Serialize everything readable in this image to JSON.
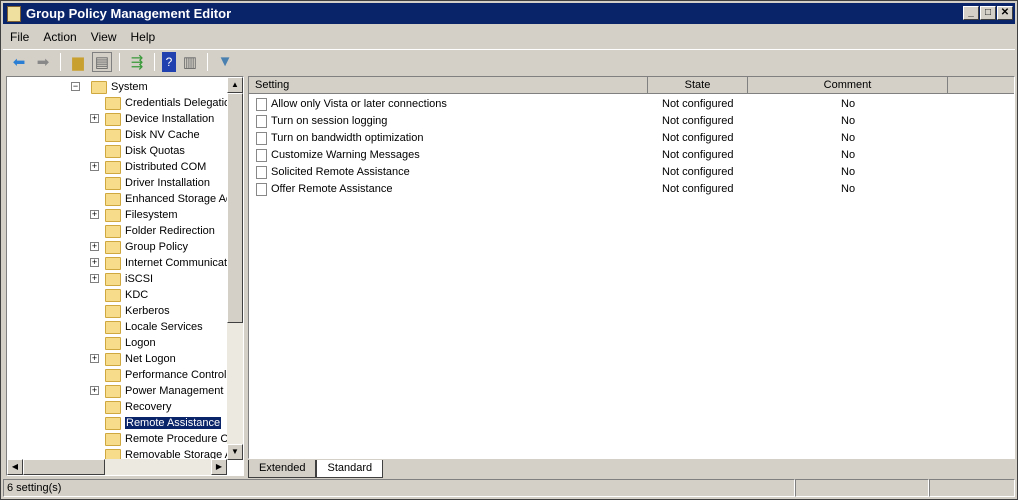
{
  "window": {
    "title": "Group Policy Management Editor",
    "controls": [
      "_",
      "□",
      "✕"
    ]
  },
  "menu": [
    "File",
    "Action",
    "View",
    "Help"
  ],
  "toolbar": [
    "back-icon",
    "forward-icon",
    "up-folder-icon",
    "show-hide-tree-icon",
    "export-list-icon",
    "help-icon",
    "show-action-pane-icon",
    "filter-icon"
  ],
  "tree": {
    "root": {
      "label": "System",
      "expanded": true
    },
    "items": [
      {
        "label": "Credentials Delegatio",
        "expandable": false
      },
      {
        "label": "Device Installation",
        "expandable": true
      },
      {
        "label": "Disk NV Cache",
        "expandable": false
      },
      {
        "label": "Disk Quotas",
        "expandable": false
      },
      {
        "label": "Distributed COM",
        "expandable": true
      },
      {
        "label": "Driver Installation",
        "expandable": false
      },
      {
        "label": "Enhanced Storage Ac",
        "expandable": false
      },
      {
        "label": "Filesystem",
        "expandable": true
      },
      {
        "label": "Folder Redirection",
        "expandable": false
      },
      {
        "label": "Group Policy",
        "expandable": true
      },
      {
        "label": "Internet Communicati",
        "expandable": true
      },
      {
        "label": "iSCSI",
        "expandable": true
      },
      {
        "label": "KDC",
        "expandable": false
      },
      {
        "label": "Kerberos",
        "expandable": false
      },
      {
        "label": "Locale Services",
        "expandable": false
      },
      {
        "label": "Logon",
        "expandable": false
      },
      {
        "label": "Net Logon",
        "expandable": true
      },
      {
        "label": "Performance Control",
        "expandable": false
      },
      {
        "label": "Power Management",
        "expandable": true
      },
      {
        "label": "Recovery",
        "expandable": false
      },
      {
        "label": "Remote Assistance",
        "expandable": false,
        "selected": true
      },
      {
        "label": "Remote Procedure C",
        "expandable": false
      },
      {
        "label": "Removable Storage A",
        "expandable": false
      }
    ]
  },
  "list": {
    "columns": [
      "Setting",
      "State",
      "Comment"
    ],
    "rows": [
      [
        "Allow only Vista or later connections",
        "Not configured",
        "No"
      ],
      [
        "Turn on session logging",
        "Not configured",
        "No"
      ],
      [
        "Turn on bandwidth optimization",
        "Not configured",
        "No"
      ],
      [
        "Customize Warning Messages",
        "Not configured",
        "No"
      ],
      [
        "Solicited Remote Assistance",
        "Not configured",
        "No"
      ],
      [
        "Offer Remote Assistance",
        "Not configured",
        "No"
      ]
    ]
  },
  "tabs": [
    {
      "label": "Extended",
      "active": false
    },
    {
      "label": "Standard",
      "active": true
    }
  ],
  "status": {
    "text": "6 setting(s)"
  }
}
